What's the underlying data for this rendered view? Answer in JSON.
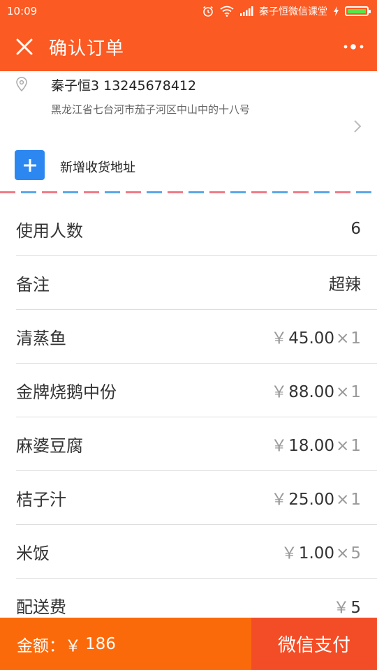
{
  "status_bar": {
    "time": "10:09",
    "carrier": "秦子恒微信课堂"
  },
  "header": {
    "title": "确认订单"
  },
  "address": {
    "name_phone": "秦子恒3 13245678412",
    "detail": "黑龙江省七台河市茄子河区中山中的十八号"
  },
  "add_address": {
    "label": "新增收货地址"
  },
  "order": {
    "people": {
      "label": "使用人数",
      "value": "6"
    },
    "note": {
      "label": "备注",
      "value": "超辣"
    },
    "items": [
      {
        "name": "清蒸鱼",
        "price": "45.00",
        "qty": "1"
      },
      {
        "name": "金牌烧鹅中份",
        "price": "88.00",
        "qty": "1"
      },
      {
        "name": "麻婆豆腐",
        "price": "18.00",
        "qty": "1"
      },
      {
        "name": "桔子汁",
        "price": "25.00",
        "qty": "1"
      },
      {
        "name": "米饭",
        "price": "1.00",
        "qty": "5"
      }
    ],
    "delivery": {
      "label": "配送费",
      "value": "5"
    },
    "currency_symbol": "￥",
    "times_symbol": "×"
  },
  "footer": {
    "total_label": "金额：",
    "currency_symbol": "￥",
    "total_value": "186",
    "pay_label": "微信支付"
  },
  "colors": {
    "accent": "#fb5a22",
    "footer_bg": "#fb6a0a",
    "pay_button": "#f34d27",
    "add_button": "#2d87f0"
  }
}
